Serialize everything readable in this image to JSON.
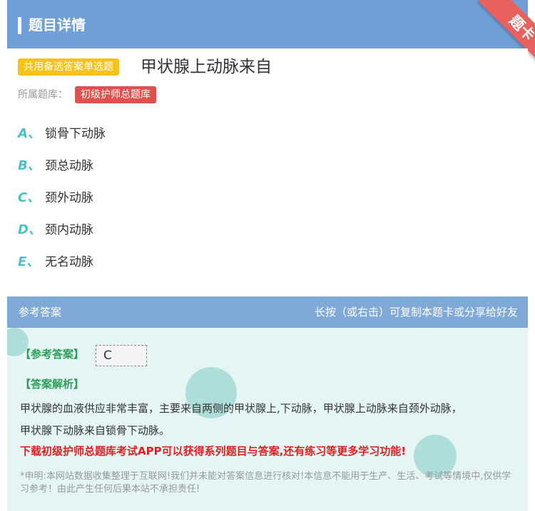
{
  "header": {
    "title": "题目详情",
    "ribbon": "题卡"
  },
  "question": {
    "type_tag": "共用备选答案单选题",
    "title": "甲状腺上动脉来自",
    "library_label": "所属题库：",
    "library_name": "初级护师总题库",
    "options": [
      {
        "letter": "A、",
        "text": "锁骨下动脉"
      },
      {
        "letter": "B、",
        "text": "颈总动脉"
      },
      {
        "letter": "C、",
        "text": "颈外动脉"
      },
      {
        "letter": "D、",
        "text": "颈内动脉"
      },
      {
        "letter": "E、",
        "text": "无名动脉"
      }
    ]
  },
  "answer": {
    "section_title": "参考答案",
    "share_hint": "长按（或右击）可复制本题卡或分享给好友",
    "answer_label": "【参考答案】",
    "answer_value": "C",
    "analysis_label": "【答案解析】",
    "analysis_line1": "甲状腺的血液供应非常丰富，主要来自两侧的甲状腺上,下动脉，甲状腺上动脉来自颈外动脉，",
    "analysis_line2": "甲状腺下动脉来自锁骨下动脉。",
    "promo": "下载初级护师总题库考试APP可以获得系列题目与答案,还有练习等更多学习功能!",
    "disclaimer": "*申明:本网站数据收集整理于互联网!我们并未能对答案信息进行核对!本信息不能用于生产、生活、考试等情境中,仅供学习参考！由此产生任何后果本站不承担责任!"
  },
  "colors": {
    "header_bg": "#6f9fd6",
    "accent_teal": "#4dc0c8",
    "tag_yellow": "#f8c21d",
    "tag_red": "#e0514e",
    "answer_green": "#2aa05a",
    "promo_red": "#e02020"
  }
}
